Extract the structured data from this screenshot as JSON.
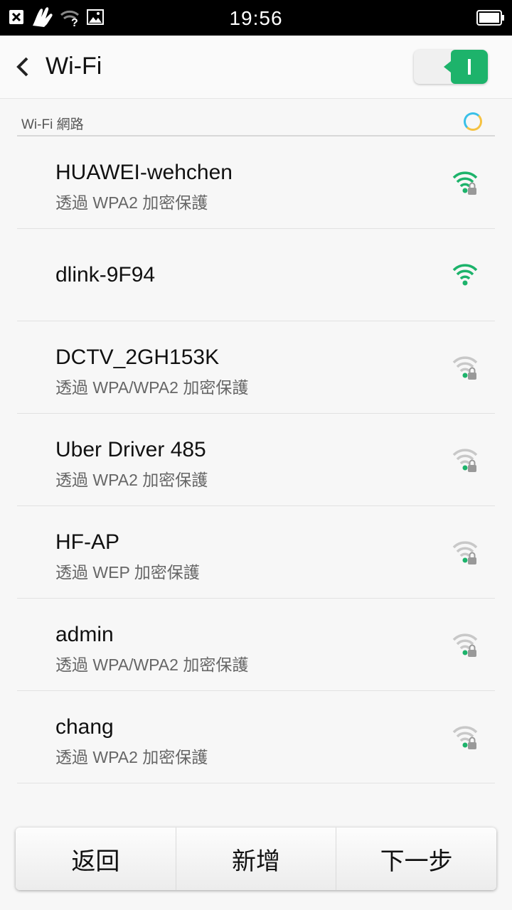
{
  "status": {
    "time": "19:56",
    "icons": [
      "close-box-icon",
      "hand-gesture-icon",
      "wifi-unknown-icon",
      "image-icon",
      "battery-icon"
    ]
  },
  "appbar": {
    "title": "Wi-Fi",
    "toggle_state": "on"
  },
  "section": {
    "label": "Wi-Fi 網路"
  },
  "networks": [
    {
      "ssid": "HUAWEI-wehchen",
      "security": "透過 WPA2 加密保護",
      "strength": "full",
      "locked": true
    },
    {
      "ssid": "dlink-9F94",
      "security": "",
      "strength": "full",
      "locked": false
    },
    {
      "ssid": "DCTV_2GH153K",
      "security": "透過 WPA/WPA2 加密保護",
      "strength": "weak",
      "locked": true
    },
    {
      "ssid": "Uber Driver 485",
      "security": "透過 WPA2 加密保護",
      "strength": "weak",
      "locked": true
    },
    {
      "ssid": "HF-AP",
      "security": "透過 WEP 加密保護",
      "strength": "weak",
      "locked": true
    },
    {
      "ssid": "admin",
      "security": "透過 WPA/WPA2 加密保護",
      "strength": "weak",
      "locked": true
    },
    {
      "ssid": "chang",
      "security": "透過 WPA2 加密保護",
      "strength": "weak",
      "locked": true
    }
  ],
  "buttons": {
    "back": "返回",
    "add": "新增",
    "next": "下一步"
  },
  "colors": {
    "accent": "#1db36b",
    "weak_signal": "#c8c8c8"
  }
}
